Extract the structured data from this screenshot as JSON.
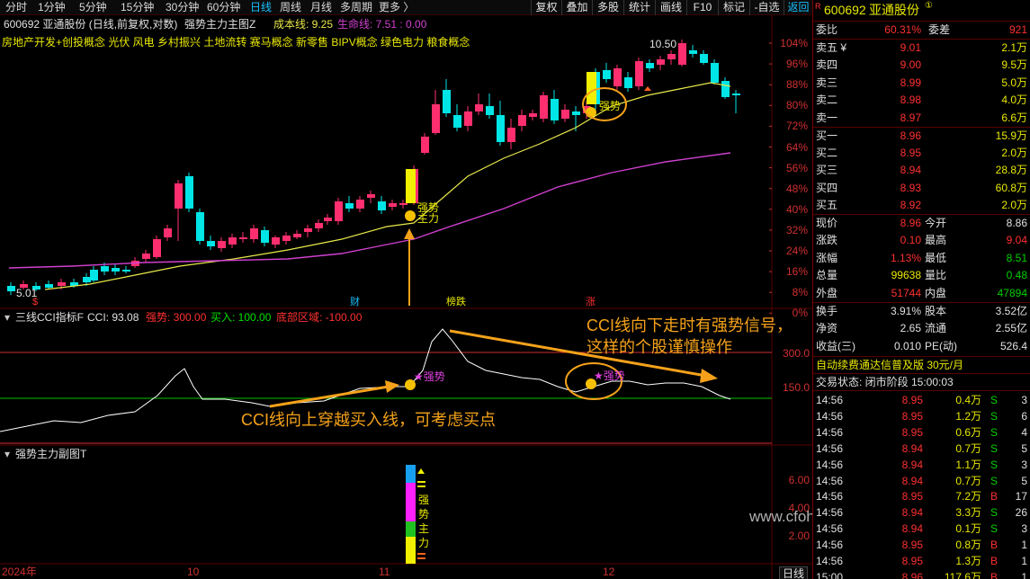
{
  "toolbar": {
    "periods": [
      "分时",
      "1分钟",
      "5分钟",
      "15分钟",
      "30分钟",
      "60分钟",
      "日线",
      "周线",
      "月线",
      "多周期",
      "更多 〉"
    ],
    "active_period": "日线",
    "right_buttons": [
      "复权",
      "叠加",
      "多股",
      "统计",
      "画线",
      "F10",
      "标记",
      "-自选",
      "返回"
    ]
  },
  "header": {
    "stock": "600692 亚通股份 (日线,前复权,对数)",
    "indicator_name": "强势主力主图Z",
    "cost_line": "成本线: 9.25",
    "life_line": "生命线: 7.51 : 0.00"
  },
  "concepts": "房地产开发+创投概念 光伏 风电 乡村振兴 土地流转 赛马概念 新零售 BIPV概念 绿色电力 粮食概念",
  "main_chart": {
    "y_pct_labels": [
      "104%",
      "96%",
      "88%",
      "80%",
      "72%",
      "64%",
      "56%",
      "48%",
      "40%",
      "32%",
      "24%",
      "16%",
      "8%",
      "0%"
    ],
    "high_label": "10.50",
    "low_label": "5.01",
    "signal_labels": [
      "强势",
      "主力",
      "强势"
    ],
    "event_markers": [
      "$",
      "财",
      "榜跌",
      "涨"
    ]
  },
  "cci_panel": {
    "title": "三线CCI指标F",
    "cci": "CCI: 93.08",
    "strong": "强势: 300.00",
    "buy": "买入: 100.00",
    "bottom": "底部区域: -100.00",
    "y_labels": [
      "300.0",
      "150.0"
    ],
    "signal": "★强势",
    "annotation_top": "CCI线向下走时有强势信号，\n这样的个股谨慎操作",
    "annotation_bottom": "CCI线向上穿越买入线，可考虑买点"
  },
  "sub_panel": {
    "title": "强势主力副图T",
    "y_labels": [
      "6.00",
      "4.00",
      "2.00"
    ],
    "bar_text": [
      "强",
      "势",
      "主",
      "力"
    ],
    "watermark": "www.cfohr.com"
  },
  "date_axis": [
    "2024年",
    "10",
    "11",
    "12"
  ],
  "period_label": "日线",
  "quote": {
    "code": "600692",
    "name": "亚通股份",
    "webi_label": "委比",
    "webi": "60.31%",
    "weicha_label": "委差",
    "weicha": "921",
    "asks": [
      {
        "label": "卖五 ¥",
        "price": "9.01",
        "vol": "2.1万"
      },
      {
        "label": "卖四",
        "price": "9.00",
        "vol": "9.5万"
      },
      {
        "label": "卖三",
        "price": "8.99",
        "vol": "5.0万"
      },
      {
        "label": "卖二",
        "price": "8.98",
        "vol": "4.0万"
      },
      {
        "label": "卖一",
        "price": "8.97",
        "vol": "6.6万"
      }
    ],
    "bids": [
      {
        "label": "买一",
        "price": "8.96",
        "vol": "15.9万"
      },
      {
        "label": "买二",
        "price": "8.95",
        "vol": "2.0万"
      },
      {
        "label": "买三",
        "price": "8.94",
        "vol": "28.8万"
      },
      {
        "label": "买四",
        "price": "8.93",
        "vol": "60.8万"
      },
      {
        "label": "买五",
        "price": "8.92",
        "vol": "2.0万"
      }
    ],
    "stats": [
      {
        "l1": "现价",
        "v1": "8.96",
        "l2": "今开",
        "v2": "8.86",
        "c1": "#ff3030",
        "c2": "#e0e0e0"
      },
      {
        "l1": "涨跌",
        "v1": "0.10",
        "l2": "最高",
        "v2": "9.04",
        "c1": "#ff3030",
        "c2": "#ff3030"
      },
      {
        "l1": "涨幅",
        "v1": "1.13%",
        "l2": "最低",
        "v2": "8.51",
        "c1": "#ff3030",
        "c2": "#00d000"
      },
      {
        "l1": "总量",
        "v1": "99638",
        "l2": "量比",
        "v2": "0.48",
        "c1": "#e8e800",
        "c2": "#00d000"
      },
      {
        "l1": "外盘",
        "v1": "51744",
        "l2": "内盘",
        "v2": "47894",
        "c1": "#ff3030",
        "c2": "#00d000"
      }
    ],
    "stats2": [
      {
        "l1": "换手",
        "v1": "3.91%",
        "l2": "股本",
        "v2": "3.52亿"
      },
      {
        "l1": "净资",
        "v1": "2.65",
        "l2": "流通",
        "v2": "2.55亿"
      },
      {
        "l1": "收益(三)",
        "v1": "0.010",
        "l2": "PE(动)",
        "v2": "526.4"
      }
    ],
    "promo": "自动续费通达信普及版  30元/月",
    "status": "交易状态: 闭市阶段 15:00:03",
    "ticks": [
      {
        "t": "14:56",
        "p": "8.95",
        "v": "0.4万",
        "s": "S",
        "n": "3"
      },
      {
        "t": "14:56",
        "p": "8.95",
        "v": "1.2万",
        "s": "S",
        "n": "6"
      },
      {
        "t": "14:56",
        "p": "8.95",
        "v": "0.6万",
        "s": "S",
        "n": "4"
      },
      {
        "t": "14:56",
        "p": "8.94",
        "v": "0.7万",
        "s": "S",
        "n": "5"
      },
      {
        "t": "14:56",
        "p": "8.94",
        "v": "1.1万",
        "s": "S",
        "n": "3"
      },
      {
        "t": "14:56",
        "p": "8.94",
        "v": "0.7万",
        "s": "S",
        "n": "5"
      },
      {
        "t": "14:56",
        "p": "8.95",
        "v": "7.2万",
        "s": "B",
        "n": "17"
      },
      {
        "t": "14:56",
        "p": "8.94",
        "v": "3.3万",
        "s": "S",
        "n": "26"
      },
      {
        "t": "14:56",
        "p": "8.94",
        "v": "0.1万",
        "s": "S",
        "n": "3"
      },
      {
        "t": "14:56",
        "p": "8.95",
        "v": "0.8万",
        "s": "B",
        "n": "1"
      },
      {
        "t": "14:56",
        "p": "8.95",
        "v": "1.3万",
        "s": "B",
        "n": "1"
      },
      {
        "t": "15:00",
        "p": "8.96",
        "v": "117.6万",
        "s": "B",
        "n": "1"
      }
    ]
  },
  "colors": {
    "up": "#ff2f6f",
    "down": "#00e5e5",
    "grid": "#5a0000",
    "cost": "#e8e84a",
    "life": "#d040d0",
    "arrow": "#f5a21a"
  }
}
